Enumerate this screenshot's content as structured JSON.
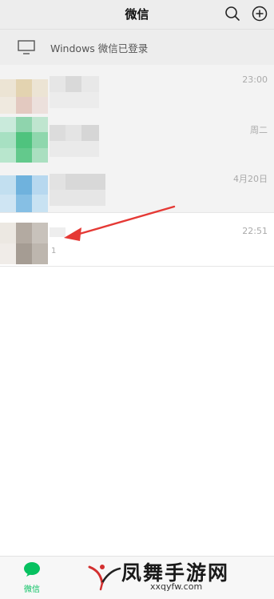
{
  "header": {
    "title": "微信"
  },
  "pc_banner": {
    "text": "Windows 微信已登录"
  },
  "chats": [
    {
      "time": "23:00",
      "preview": ""
    },
    {
      "time": "周二",
      "preview": ""
    },
    {
      "time": "4月20日",
      "preview": ""
    },
    {
      "time": "22:51",
      "preview": "1"
    }
  ],
  "tabbar": {
    "chat_label": "微信"
  },
  "watermark": {
    "brand": "凤舞手游网",
    "url": "xxqyfw.com"
  },
  "colors": {
    "accent": "#07c160",
    "arrow": "#e53935"
  }
}
